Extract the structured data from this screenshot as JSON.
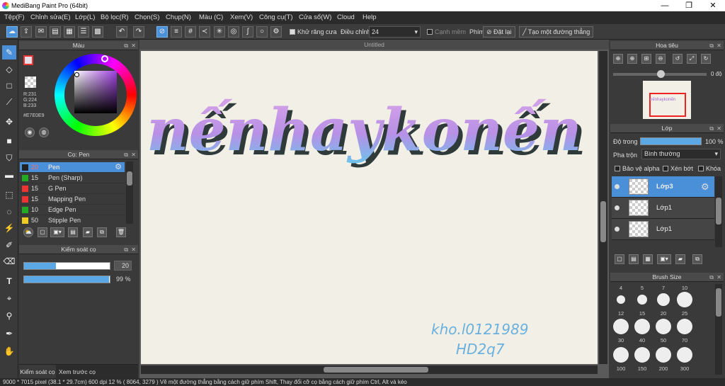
{
  "window": {
    "title": "MediBang Paint Pro (64bit)",
    "min": "—",
    "max": "❐",
    "close": "✕"
  },
  "menu": [
    "Tệp(F)",
    "Chỉnh sửa(E)",
    "Lớp(L)",
    "Bộ lọc(R)",
    "Chọn(S)",
    "Chụp(N)",
    "Màu (C)",
    "Xem(V)",
    "Công cụ(T)",
    "Cửa sổ(W)",
    "Cloud",
    "Help"
  ],
  "toolbar": {
    "antialias_label": "Khử răng cưa",
    "adjust_label": "Điều chỉnh",
    "adjust_value": "24",
    "edge_label": "Cạnh mềm",
    "key_label": "Phím",
    "reset_label": "Đặt lại",
    "line_label": "Tạo một đường thẳng"
  },
  "color_panel": {
    "title": "Màu",
    "r": "R:231",
    "g": "G:224",
    "b": "B:233",
    "hex": "#E7E0E9",
    "primary": "#e7e0e9",
    "accent": "#4a90d9"
  },
  "brush_panel": {
    "title": "Cọ: Pen",
    "items": [
      {
        "size": "20",
        "name": "Pen",
        "color": "#222222",
        "selected": true
      },
      {
        "size": "15",
        "name": "Pen (Sharp)",
        "color": "#22aa22"
      },
      {
        "size": "15",
        "name": "G Pen",
        "color": "#ee3333"
      },
      {
        "size": "15",
        "name": "Mapping Pen",
        "color": "#ee3333"
      },
      {
        "size": "10",
        "name": "Edge Pen",
        "color": "#22aa22"
      },
      {
        "size": "50",
        "name": "Stipple Pen",
        "color": "#eecc22"
      }
    ]
  },
  "brush_control": {
    "title": "Kiểm soát cọ",
    "size_value": "20",
    "size_fraction": 0.37,
    "opacity_value": "99 %",
    "opacity_fraction": 0.99
  },
  "bottom_tabs": [
    "Kiểm soát cọ",
    "Xem trước cọ"
  ],
  "canvas": {
    "title": "Untitled",
    "main_text": "nếnhaykonến",
    "sig1": "kho.l0121989",
    "sig2": "HD2q7"
  },
  "navigator": {
    "title": "Hoa tiêu",
    "angle": "0 độ"
  },
  "layer_panel": {
    "title": "Lớp",
    "opacity_label": "Độ trong",
    "opacity_value": "100 %",
    "blend_label": "Pha trộn",
    "blend_value": "Bình thường",
    "protect_alpha": "Bảo vệ alpha",
    "clip": "Xén bớt",
    "lock": "Khóa",
    "layers": [
      {
        "name": "Lớp3",
        "selected": true
      },
      {
        "name": "Lớp1"
      },
      {
        "name": "Lớp1"
      }
    ]
  },
  "brush_size": {
    "title": "Brush Size",
    "sizes": [
      "4",
      "5",
      "7",
      "10",
      "12",
      "15",
      "20",
      "25",
      "30",
      "40",
      "50",
      "70",
      "100",
      "150",
      "200",
      "300"
    ]
  },
  "status": {
    "text": "9000 * 7015 pixel   (38.1 * 29.7cm)   600 dpi   12 %   ( 8064, 3279 )   Vẽ một đường thẳng bằng cách giữ phím Shift, Thay đổi cỡ cọ bằng cách giữ phím Ctrl, Alt và kéo"
  }
}
